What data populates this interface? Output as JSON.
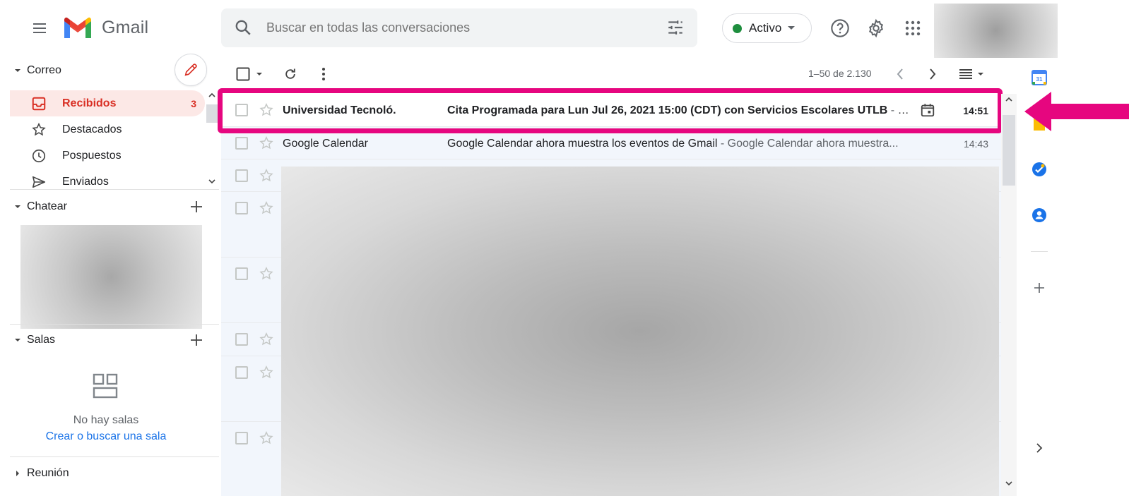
{
  "app": {
    "name": "Gmail"
  },
  "search": {
    "placeholder": "Buscar en todas las conversaciones",
    "value": ""
  },
  "status": {
    "label": "Activo",
    "color": "#1e8e3e"
  },
  "colors": {
    "accent_red": "#d93025",
    "link_blue": "#1a73e8",
    "highlight": "#e6067f"
  },
  "mail_section": {
    "title": "Correo",
    "items": [
      {
        "label": "Recibidos",
        "count": "3",
        "icon": "inbox-icon",
        "active": true
      },
      {
        "label": "Destacados",
        "icon": "star-icon"
      },
      {
        "label": "Pospuestos",
        "icon": "clock-icon"
      },
      {
        "label": "Enviados",
        "icon": "send-icon"
      }
    ]
  },
  "chat_section": {
    "title": "Chatear"
  },
  "rooms_section": {
    "title": "Salas",
    "empty_text": "No hay salas",
    "create_link": "Crear o buscar una sala"
  },
  "meet_section": {
    "title": "Reunión"
  },
  "toolbar": {
    "page_range": "1–50 de 2.130"
  },
  "emails": [
    {
      "sender": "Universidad Tecnoló.",
      "subject": "Cita Programada para Lun Jul 26, 2021 15:00 (CDT) con Servicios Escolares UTLB",
      "snippet": " - G...",
      "time": "14:51",
      "unread": true,
      "has_calendar": true
    },
    {
      "sender": "Google Calendar",
      "subject": "Google Calendar ahora muestra los eventos de Gmail",
      "snippet": " - Google Calendar ahora muestra...",
      "time": "14:43",
      "unread": false,
      "has_calendar": false
    }
  ],
  "side_apps": [
    "calendar-icon",
    "keep-icon",
    "tasks-icon",
    "contacts-icon",
    "add-addon-icon"
  ]
}
